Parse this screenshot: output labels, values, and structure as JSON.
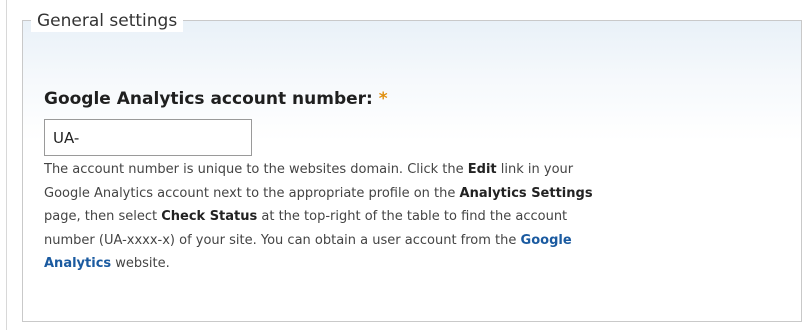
{
  "fieldset": {
    "legend": "General settings"
  },
  "account_field": {
    "label": "Google Analytics account number:",
    "required_mark": "*",
    "value": "UA-"
  },
  "description": {
    "line1": {
      "a": "The account number is unique to the websites domain. Click the ",
      "b": "Edit",
      "c": " link in your"
    },
    "line2": {
      "a": "Google Analytics account next to the appropriate profile on the ",
      "b": "Analytics Settings"
    },
    "line3": {
      "a": "page, then select ",
      "b": "Check Status",
      "c": " at the top-right of the table to find the account"
    },
    "line4": {
      "a": "number (UA-xxxx-x) of your site. You can obtain a user account from the ",
      "link": "Google"
    },
    "line5": {
      "link": "Analytics",
      "a": " website."
    }
  },
  "colors": {
    "link": "#1a5aa0",
    "required": "#e09010",
    "fieldset_top": "#e9f1f8"
  }
}
